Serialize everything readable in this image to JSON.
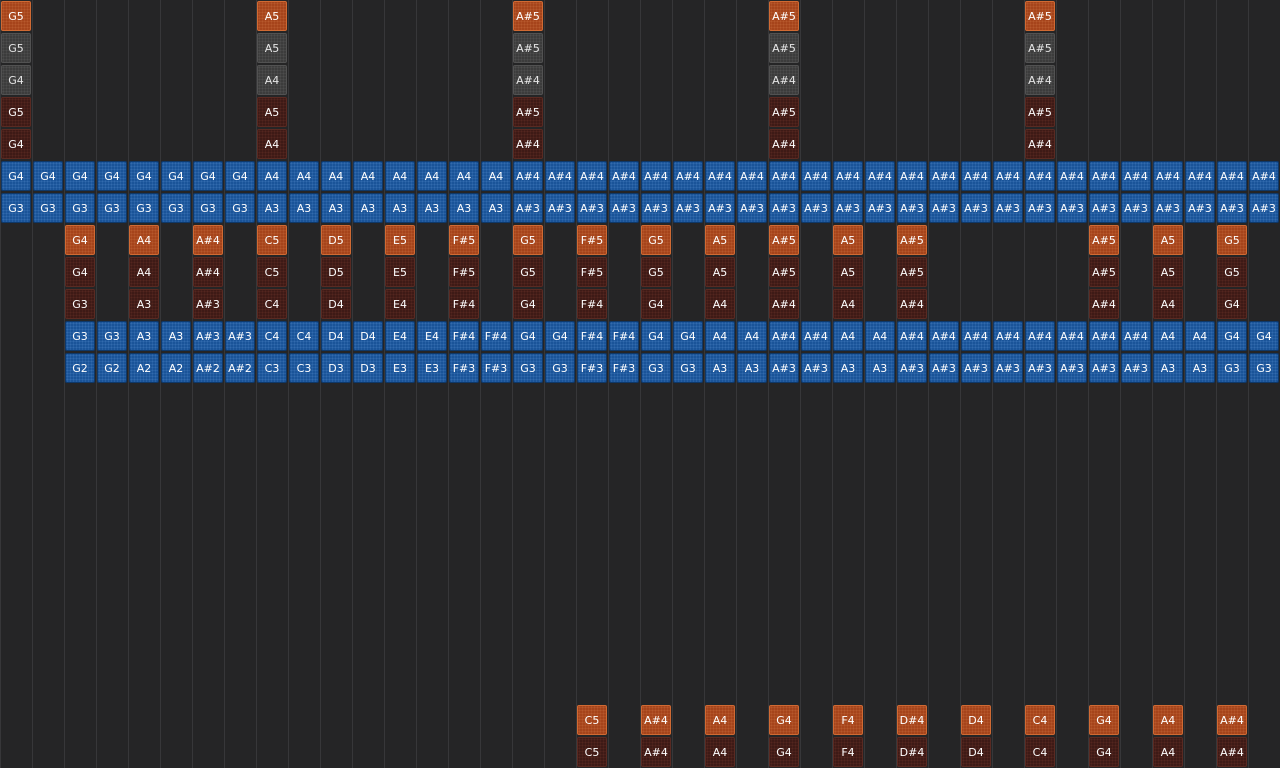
{
  "colors": {
    "background": "#252526",
    "grid_line": "#373739",
    "note_blue": "#1a5499",
    "note_orange": "#a6441b",
    "note_dark": "#3e1a16",
    "note_gray": "#3c3c3c"
  },
  "note_rows": [
    {
      "style": "orange",
      "cells": {
        "0": "G5",
        "8": "A5",
        "16": "A#5",
        "24": "A#5",
        "32": "A#5"
      }
    },
    {
      "style": "gray",
      "cells": {
        "0": "G5",
        "8": "A5",
        "16": "A#5",
        "24": "A#5",
        "32": "A#5"
      }
    },
    {
      "style": "gray",
      "cells": {
        "0": "G4",
        "8": "A4",
        "16": "A#4",
        "24": "A#4",
        "32": "A#4"
      }
    },
    {
      "style": "dark",
      "cells": {
        "0": "G5",
        "8": "A5",
        "16": "A#5",
        "24": "A#5",
        "32": "A#5"
      }
    },
    {
      "style": "dark",
      "cells": {
        "0": "G4",
        "8": "A4",
        "16": "A#4",
        "24": "A#4",
        "32": "A#4"
      }
    },
    {
      "style": "blue",
      "cells": {
        "0": "G4",
        "1": "G4",
        "2": "G4",
        "3": "G4",
        "4": "G4",
        "5": "G4",
        "6": "G4",
        "7": "G4",
        "8": "A4",
        "9": "A4",
        "10": "A4",
        "11": "A4",
        "12": "A4",
        "13": "A4",
        "14": "A4",
        "15": "A4",
        "16": "A#4",
        "17": "A#4",
        "18": "A#4",
        "19": "A#4",
        "20": "A#4",
        "21": "A#4",
        "22": "A#4",
        "23": "A#4",
        "24": "A#4",
        "25": "A#4",
        "26": "A#4",
        "27": "A#4",
        "28": "A#4",
        "29": "A#4",
        "30": "A#4",
        "31": "A#4",
        "32": "A#4",
        "33": "A#4",
        "34": "A#4",
        "35": "A#4",
        "36": "A#4",
        "37": "A#4",
        "38": "A#4",
        "39": "A#4"
      }
    },
    {
      "style": "blue",
      "cells": {
        "0": "G3",
        "1": "G3",
        "2": "G3",
        "3": "G3",
        "4": "G3",
        "5": "G3",
        "6": "G3",
        "7": "G3",
        "8": "A3",
        "9": "A3",
        "10": "A3",
        "11": "A3",
        "12": "A3",
        "13": "A3",
        "14": "A3",
        "15": "A3",
        "16": "A#3",
        "17": "A#3",
        "18": "A#3",
        "19": "A#3",
        "20": "A#3",
        "21": "A#3",
        "22": "A#3",
        "23": "A#3",
        "24": "A#3",
        "25": "A#3",
        "26": "A#3",
        "27": "A#3",
        "28": "A#3",
        "29": "A#3",
        "30": "A#3",
        "31": "A#3",
        "32": "A#3",
        "33": "A#3",
        "34": "A#3",
        "35": "A#3",
        "36": "A#3",
        "37": "A#3",
        "38": "A#3",
        "39": "A#3"
      }
    },
    {
      "style": "orange",
      "cells": {
        "2": "G4",
        "4": "A4",
        "6": "A#4",
        "8": "C5",
        "10": "D5",
        "12": "E5",
        "14": "F#5",
        "16": "G5",
        "18": "F#5",
        "20": "G5",
        "22": "A5",
        "24": "A#5",
        "26": "A5",
        "28": "A#5",
        "34": "A#5",
        "36": "A5",
        "38": "G5"
      }
    },
    {
      "style": "dark",
      "cells": {
        "2": "G4",
        "4": "A4",
        "6": "A#4",
        "8": "C5",
        "10": "D5",
        "12": "E5",
        "14": "F#5",
        "16": "G5",
        "18": "F#5",
        "20": "G5",
        "22": "A5",
        "24": "A#5",
        "26": "A5",
        "28": "A#5",
        "34": "A#5",
        "36": "A5",
        "38": "G5"
      }
    },
    {
      "style": "dark",
      "cells": {
        "2": "G3",
        "4": "A3",
        "6": "A#3",
        "8": "C4",
        "10": "D4",
        "12": "E4",
        "14": "F#4",
        "16": "G4",
        "18": "F#4",
        "20": "G4",
        "22": "A4",
        "24": "A#4",
        "26": "A4",
        "28": "A#4",
        "34": "A#4",
        "36": "A4",
        "38": "G4"
      }
    },
    {
      "style": "blue",
      "cells": {
        "2": "G3",
        "3": "G3",
        "4": "A3",
        "5": "A3",
        "6": "A#3",
        "7": "A#3",
        "8": "C4",
        "9": "C4",
        "10": "D4",
        "11": "D4",
        "12": "E4",
        "13": "E4",
        "14": "F#4",
        "15": "F#4",
        "16": "G4",
        "17": "G4",
        "18": "F#4",
        "19": "F#4",
        "20": "G4",
        "21": "G4",
        "22": "A4",
        "23": "A4",
        "24": "A#4",
        "25": "A#4",
        "26": "A4",
        "27": "A4",
        "28": "A#4",
        "29": "A#4",
        "30": "A#4",
        "31": "A#4",
        "32": "A#4",
        "33": "A#4",
        "34": "A#4",
        "35": "A#4",
        "36": "A4",
        "37": "A4",
        "38": "G4",
        "39": "G4"
      }
    },
    {
      "style": "blue",
      "cells": {
        "2": "G2",
        "3": "G2",
        "4": "A2",
        "5": "A2",
        "6": "A#2",
        "7": "A#2",
        "8": "C3",
        "9": "C3",
        "10": "D3",
        "11": "D3",
        "12": "E3",
        "13": "E3",
        "14": "F#3",
        "15": "F#3",
        "16": "G3",
        "17": "G3",
        "18": "F#3",
        "19": "F#3",
        "20": "G3",
        "21": "G3",
        "22": "A3",
        "23": "A3",
        "24": "A#3",
        "25": "A#3",
        "26": "A3",
        "27": "A3",
        "28": "A#3",
        "29": "A#3",
        "30": "A#3",
        "31": "A#3",
        "32": "A#3",
        "33": "A#3",
        "34": "A#3",
        "35": "A#3",
        "36": "A3",
        "37": "A3",
        "38": "G3",
        "39": "G3"
      }
    },
    {
      "style": "empty",
      "cells": {}
    },
    {
      "style": "empty",
      "cells": {}
    },
    {
      "style": "empty",
      "cells": {}
    },
    {
      "style": "empty",
      "cells": {}
    },
    {
      "style": "empty",
      "cells": {}
    },
    {
      "style": "empty",
      "cells": {}
    },
    {
      "style": "empty",
      "cells": {}
    },
    {
      "style": "empty",
      "cells": {}
    },
    {
      "style": "empty",
      "cells": {}
    },
    {
      "style": "empty",
      "cells": {}
    },
    {
      "style": "orange",
      "cells": {
        "18": "C5",
        "20": "A#4",
        "22": "A4",
        "24": "G4",
        "26": "F4",
        "28": "D#4",
        "30": "D4",
        "32": "C4",
        "34": "G4",
        "36": "A4",
        "38": "A#4"
      }
    },
    {
      "style": "dark",
      "cells": {
        "18": "C5",
        "20": "A#4",
        "22": "A4",
        "24": "G4",
        "26": "F4",
        "28": "D#4",
        "30": "D4",
        "32": "C4",
        "34": "G4",
        "36": "A4",
        "38": "A#4"
      }
    }
  ]
}
